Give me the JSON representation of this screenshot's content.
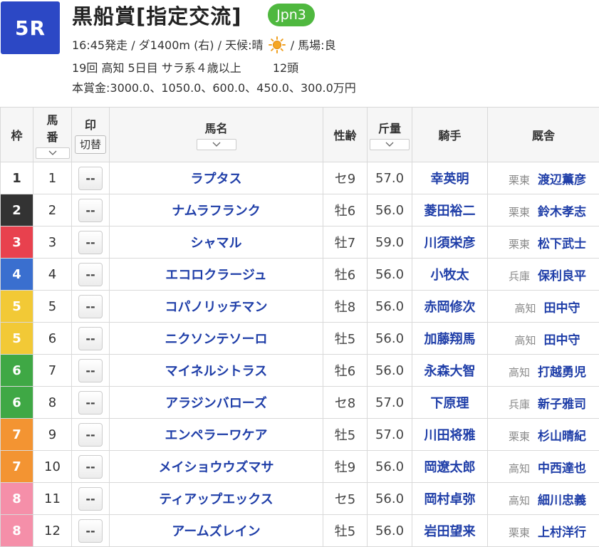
{
  "race": {
    "number": "5R",
    "name": "黒船賞[指定交流]",
    "grade": "Jpn3",
    "start_time_course": "16:45発走 / ダ1400m (右) / 天候:晴",
    "weather_icon": "sun-icon",
    "track_condition": "/ 馬場:良",
    "meeting": "19回 高知 5日目 サラ系４歳以上",
    "heads": "12頭",
    "prize": "本賞金:3000.0、1050.0、600.0、450.0、300.0万円"
  },
  "table": {
    "headers": {
      "waku": "枠",
      "umaban_top": "馬",
      "umaban_bottom": "番",
      "mark": "印",
      "mark_toggle": "切替",
      "horse": "馬名",
      "sex_age": "性齢",
      "weight": "斤量",
      "jockey": "騎手",
      "stable": "厩舎"
    },
    "mark_placeholder": "--",
    "rows": [
      {
        "waku": "1",
        "umaban": "1",
        "horse": "ラプタス",
        "sex_age": "セ9",
        "weight": "57.0",
        "jockey": "幸英明",
        "region": "栗東",
        "trainer": "渡辺薫彦"
      },
      {
        "waku": "2",
        "umaban": "2",
        "horse": "ナムラフランク",
        "sex_age": "牡6",
        "weight": "56.0",
        "jockey": "菱田裕二",
        "region": "栗東",
        "trainer": "鈴木孝志"
      },
      {
        "waku": "3",
        "umaban": "3",
        "horse": "シャマル",
        "sex_age": "牡7",
        "weight": "59.0",
        "jockey": "川須栄彦",
        "region": "栗東",
        "trainer": "松下武士"
      },
      {
        "waku": "4",
        "umaban": "4",
        "horse": "エコロクラージュ",
        "sex_age": "牡6",
        "weight": "56.0",
        "jockey": "小牧太",
        "region": "兵庫",
        "trainer": "保利良平"
      },
      {
        "waku": "5",
        "umaban": "5",
        "horse": "コパノリッチマン",
        "sex_age": "牡8",
        "weight": "56.0",
        "jockey": "赤岡修次",
        "region": "高知",
        "trainer": "田中守"
      },
      {
        "waku": "5",
        "umaban": "6",
        "horse": "ニクソンテソーロ",
        "sex_age": "牡5",
        "weight": "56.0",
        "jockey": "加藤翔馬",
        "region": "高知",
        "trainer": "田中守"
      },
      {
        "waku": "6",
        "umaban": "7",
        "horse": "マイネルシトラス",
        "sex_age": "牡6",
        "weight": "56.0",
        "jockey": "永森大智",
        "region": "高知",
        "trainer": "打越勇児"
      },
      {
        "waku": "6",
        "umaban": "8",
        "horse": "アラジンバローズ",
        "sex_age": "セ8",
        "weight": "57.0",
        "jockey": "下原理",
        "region": "兵庫",
        "trainer": "新子雅司"
      },
      {
        "waku": "7",
        "umaban": "9",
        "horse": "エンペラーワケア",
        "sex_age": "牡5",
        "weight": "57.0",
        "jockey": "川田将雅",
        "region": "栗東",
        "trainer": "杉山晴紀"
      },
      {
        "waku": "7",
        "umaban": "10",
        "horse": "メイショウウズマサ",
        "sex_age": "牡9",
        "weight": "56.0",
        "jockey": "岡遼太郎",
        "region": "高知",
        "trainer": "中西達也"
      },
      {
        "waku": "8",
        "umaban": "11",
        "horse": "ティアップエックス",
        "sex_age": "セ5",
        "weight": "56.0",
        "jockey": "岡村卓弥",
        "region": "高知",
        "trainer": "細川忠義"
      },
      {
        "waku": "8",
        "umaban": "12",
        "horse": "アームズレイン",
        "sex_age": "牡5",
        "weight": "56.0",
        "jockey": "岩田望来",
        "region": "栗東",
        "trainer": "上村洋行"
      }
    ]
  },
  "colors": {
    "race_badge": "#2c48c5",
    "grade_badge": "#4fb83f",
    "link_text": "#1f3ea8",
    "waku": {
      "1": {
        "bg": "#ffffff",
        "fg": "#333333"
      },
      "2": {
        "bg": "#333333",
        "fg": "#ffffff"
      },
      "3": {
        "bg": "#e8414e",
        "fg": "#ffffff"
      },
      "4": {
        "bg": "#3a6fcf",
        "fg": "#ffffff"
      },
      "5": {
        "bg": "#f2c936",
        "fg": "#ffffff"
      },
      "6": {
        "bg": "#3fa845",
        "fg": "#ffffff"
      },
      "7": {
        "bg": "#f39432",
        "fg": "#ffffff"
      },
      "8": {
        "bg": "#f58fa9",
        "fg": "#ffffff"
      }
    }
  }
}
